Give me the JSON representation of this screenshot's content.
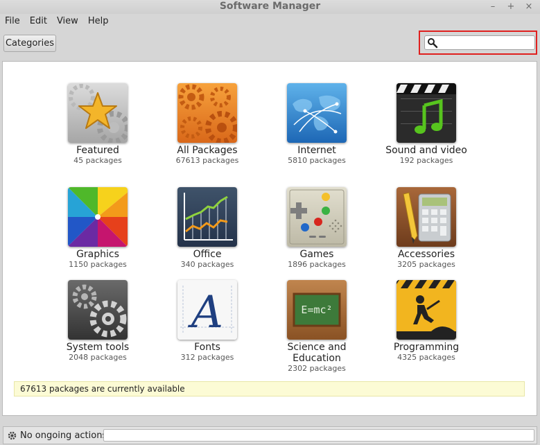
{
  "window": {
    "title": "Software Manager",
    "controls": [
      "–",
      "+",
      "×"
    ]
  },
  "menu": [
    "File",
    "Edit",
    "View",
    "Help"
  ],
  "toolbar": {
    "categories_label": "Categories",
    "search_placeholder": "",
    "search_value": ""
  },
  "categories": [
    {
      "name": "Featured",
      "count": "45 packages",
      "icon": "star-icon"
    },
    {
      "name": "All Packages",
      "count": "67613 packages",
      "icon": "gears-icon"
    },
    {
      "name": "Internet",
      "count": "5810 packages",
      "icon": "globe-icon"
    },
    {
      "name": "Sound and video",
      "count": "192 packages",
      "icon": "music-icon"
    },
    {
      "name": "Graphics",
      "count": "1150 packages",
      "icon": "color-wheel-icon"
    },
    {
      "name": "Office",
      "count": "340 packages",
      "icon": "chart-icon"
    },
    {
      "name": "Games",
      "count": "1896 packages",
      "icon": "gamepad-icon"
    },
    {
      "name": "Accessories",
      "count": "3205 packages",
      "icon": "calculator-icon"
    },
    {
      "name": "System tools",
      "count": "2048 packages",
      "icon": "system-gears-icon"
    },
    {
      "name": "Fonts",
      "count": "312 packages",
      "icon": "font-icon"
    },
    {
      "name": "Science and Education",
      "count": "2302 packages",
      "icon": "chalkboard-icon"
    },
    {
      "name": "Programming",
      "count": "4325 packages",
      "icon": "construction-icon"
    }
  ],
  "status": {
    "available": "67613 packages are currently available"
  },
  "bottom": {
    "actions_label": "No ongoing actions"
  }
}
